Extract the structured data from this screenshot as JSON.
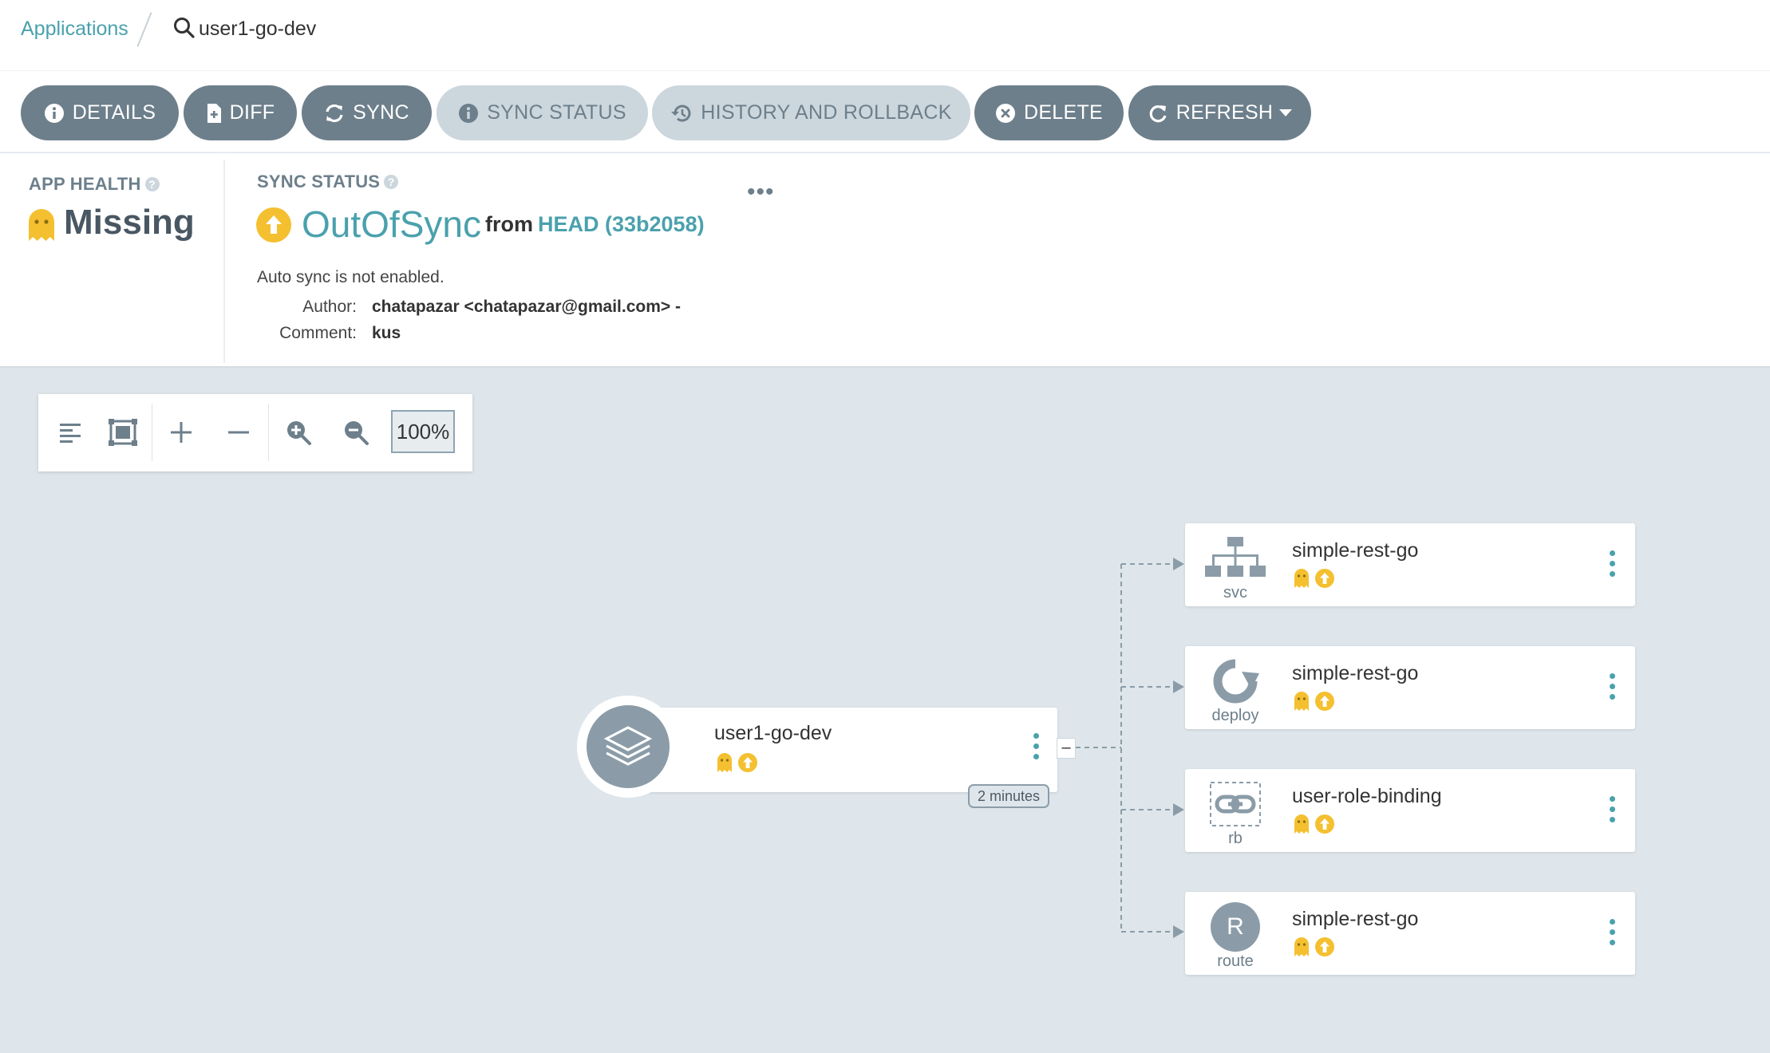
{
  "breadcrumb": {
    "parent": "Applications",
    "current": "user1-go-dev"
  },
  "actions": {
    "details": "DETAILS",
    "diff": "DIFF",
    "sync": "SYNC",
    "sync_status": "SYNC STATUS",
    "history": "HISTORY AND ROLLBACK",
    "delete": "DELETE",
    "refresh": "REFRESH"
  },
  "app_health": {
    "label": "APP HEALTH",
    "value": "Missing"
  },
  "sync_status": {
    "label": "SYNC STATUS",
    "value": "OutOfSync",
    "from": "from",
    "revision": "HEAD (33b2058)",
    "auto_sync": "Auto sync is not enabled.",
    "author_label": "Author:",
    "author": "chatapazar <chatapazar@gmail.com> -",
    "comment_label": "Comment:",
    "comment": "kus",
    "more": "•••"
  },
  "graph_toolbar": {
    "zoom": "100%"
  },
  "app_node": {
    "name": "user1-go-dev",
    "age": "2 minutes",
    "collapse": "–"
  },
  "resources": [
    {
      "name": "simple-rest-go",
      "kind": "svc",
      "icon": "network-icon"
    },
    {
      "name": "simple-rest-go",
      "kind": "deploy",
      "icon": "deploy-icon"
    },
    {
      "name": "user-role-binding",
      "kind": "rb",
      "icon": "link-icon"
    },
    {
      "name": "simple-rest-go",
      "kind": "route",
      "icon": "route-icon",
      "letter": "R"
    }
  ],
  "colors": {
    "accent": "#4aa1ad",
    "button_dark": "#6d7f8b",
    "button_light": "#ccd6dd",
    "missing": "#f4c030",
    "out_of_sync": "#f4c030",
    "canvas": "#dee6eb"
  }
}
